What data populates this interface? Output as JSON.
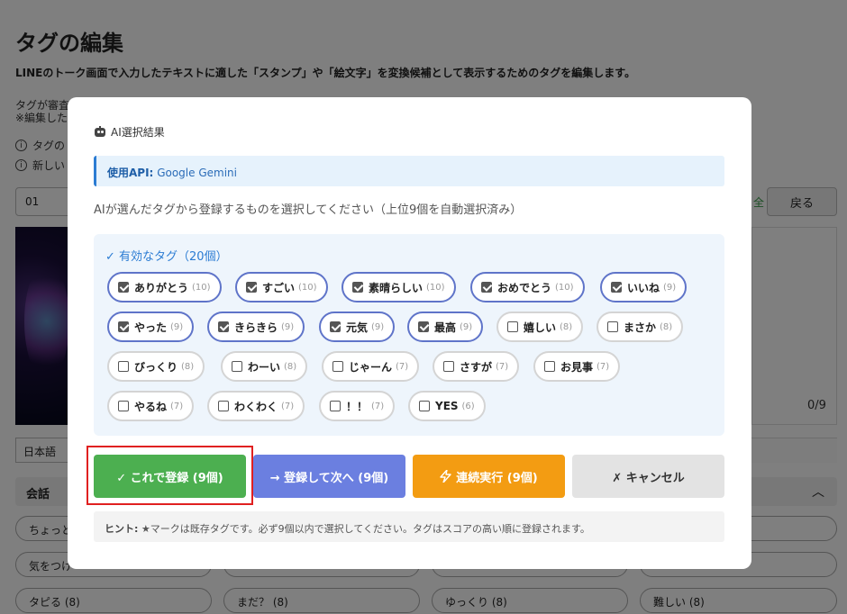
{
  "background": {
    "title": "タグの編集",
    "description": "LINEのトーク画面で入力したテキストに適した「スタンプ」や「絵文字」を変換候補として表示するためのタグを編集します。",
    "note1": "タグが審査",
    "note2": "※編集した",
    "info1": "タグの",
    "info2": "新しい",
    "input_value": "01",
    "back_label": "戻る",
    "accent_fragment": "全",
    "count": "0/9",
    "language": "日本語",
    "section_label": "会話",
    "pills": [
      "ちょっと",
      "気をつけ",
      "タピる (8)",
      "まだ？ (8)",
      "ゆっくり (8)",
      "難しい (8)"
    ]
  },
  "modal": {
    "header": "AI選択結果",
    "api_label": "使用API:",
    "api_value": "Google Gemini",
    "instruction": "AIが選んだタグから登録するものを選択してください（上位9個を自動選択済み）",
    "tags_heading": "✓ 有効なタグ（20個）",
    "tags": [
      {
        "name": "ありがとう",
        "count": "(10)",
        "checked": true
      },
      {
        "name": "すごい",
        "count": "(10)",
        "checked": true
      },
      {
        "name": "素晴らしい",
        "count": "(10)",
        "checked": true
      },
      {
        "name": "おめでとう",
        "count": "(10)",
        "checked": true
      },
      {
        "name": "いいね",
        "count": "(9)",
        "checked": true
      },
      {
        "name": "やった",
        "count": "(9)",
        "checked": true
      },
      {
        "name": "きらきら",
        "count": "(9)",
        "checked": true
      },
      {
        "name": "元気",
        "count": "(9)",
        "checked": true
      },
      {
        "name": "最高",
        "count": "(9)",
        "checked": true
      },
      {
        "name": "嬉しい",
        "count": "(8)",
        "checked": false
      },
      {
        "name": "まさか",
        "count": "(8)",
        "checked": false
      },
      {
        "name": "びっくり",
        "count": "(8)",
        "checked": false
      },
      {
        "name": "わーい",
        "count": "(8)",
        "checked": false
      },
      {
        "name": "じゃーん",
        "count": "(7)",
        "checked": false
      },
      {
        "name": "さすが",
        "count": "(7)",
        "checked": false
      },
      {
        "name": "お見事",
        "count": "(7)",
        "checked": false
      },
      {
        "name": "やるね",
        "count": "(7)",
        "checked": false
      },
      {
        "name": "わくわく",
        "count": "(7)",
        "checked": false
      },
      {
        "name": "！！",
        "count": "(7)",
        "checked": false
      },
      {
        "name": "YES",
        "count": "(6)",
        "checked": false
      }
    ],
    "buttons": {
      "register": "✓ これで登録 (9個)",
      "register_next": "→ 登録して次へ (9個)",
      "continuous": "連続実行 (9個)",
      "cancel": "✗ キャンセル"
    },
    "hint_label": "ヒント:",
    "hint_text": " ★マークは既存タグです。必ず9個以内で選択してください。タグはスコアの高い順に登録されます。"
  }
}
